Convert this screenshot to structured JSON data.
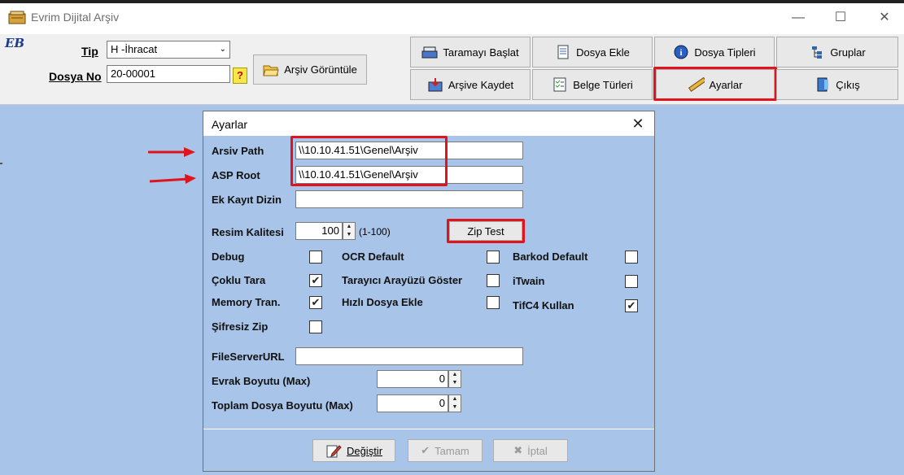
{
  "window": {
    "title": "Evrim Dijital Arşiv",
    "minimize": "—",
    "maximize": "☐",
    "close": "✕"
  },
  "logo": "EB",
  "form": {
    "tip_label": "Tip",
    "tip_value": "H -İhracat",
    "dosya_label": "Dosya No",
    "dosya_value": "20-00001",
    "help": "?",
    "arsiv_goruntule": "Arşiv Görüntüle"
  },
  "toolbar": {
    "taramayi_baslat": "Taramayı Başlat",
    "dosya_ekle": "Dosya Ekle",
    "dosya_tipleri": "Dosya Tipleri",
    "gruplar": "Gruplar",
    "arsive_kaydet": "Arşive Kaydet",
    "belge_turleri": "Belge Türleri",
    "ayarlar": "Ayarlar",
    "cikis": "Çıkış"
  },
  "dialog": {
    "title": "Ayarlar",
    "close": "✕",
    "arsiv_path_label": "Arsiv Path",
    "arsiv_path_value": "\\\\10.10.41.51\\Genel\\Arşiv",
    "asp_root_label": "ASP Root",
    "asp_root_value": "\\\\10.10.41.51\\Genel\\Arşiv",
    "ek_kayit_label": "Ek Kayıt Dizin",
    "ek_kayit_value": "",
    "resim_kalitesi_label": "Resim Kalitesi",
    "resim_kalitesi_value": "100",
    "resim_range": "(1-100)",
    "zip_test": "Zip Test",
    "checkboxes": {
      "debug": {
        "label": "Debug",
        "checked": false
      },
      "coklu_tara": {
        "label": "Çoklu Tara",
        "checked": true
      },
      "memory_tran": {
        "label": "Memory Tran.",
        "checked": true
      },
      "sifresiz_zip": {
        "label": "Şifresiz Zip",
        "checked": false
      },
      "ocr_default": {
        "label": "OCR Default",
        "checked": false
      },
      "tarayici": {
        "label": "Tarayıcı Arayüzü Göster",
        "checked": false
      },
      "hizli_dosya": {
        "label": "Hızlı Dosya Ekle",
        "checked": false
      },
      "barkod_default": {
        "label": "Barkod Default",
        "checked": false
      },
      "itwain": {
        "label": "iTwain",
        "checked": false
      },
      "tifc4": {
        "label": "TifC4 Kullan",
        "checked": true
      }
    },
    "file_server_label": "FileServerURL",
    "file_server_value": "",
    "evrak_boyutu_label": "Evrak Boyutu (Max)",
    "evrak_boyutu_value": "0",
    "toplam_dosya_label": "Toplam Dosya Boyutu (Max)",
    "toplam_dosya_value": "0",
    "degistir": "Değiştir",
    "tamam": "Tamam",
    "iptal": "İptal"
  },
  "colors": {
    "highlight": "#e0141c",
    "background": "#a8c4e8"
  }
}
